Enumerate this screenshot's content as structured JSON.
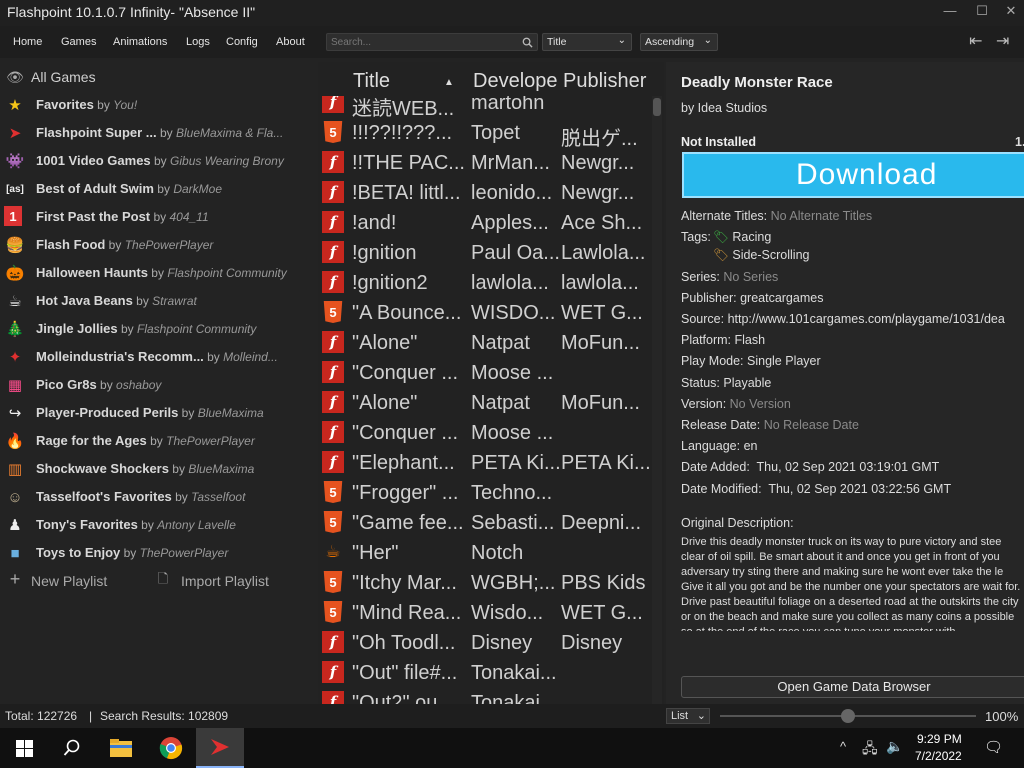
{
  "window": {
    "title": "Flashpoint 10.1.0.7 Infinity- \"Absence II\""
  },
  "menu": [
    "Home",
    "Games",
    "Animations",
    "Logs",
    "Config",
    "About"
  ],
  "search": {
    "placeholder": "Search..."
  },
  "sort": {
    "field": "Title",
    "order": "Ascending"
  },
  "sidebar": {
    "all_games": "All Games",
    "playlists": [
      {
        "name": "Favorites",
        "author": "You!",
        "icon": "star-icon"
      },
      {
        "name": "Flashpoint Super ...",
        "author": "BlueMaxima & Fla...",
        "icon": "flashpoint-icon"
      },
      {
        "name": "1001 Video Games",
        "author": "Gibus Wearing Brony",
        "icon": "space-invader-icon"
      },
      {
        "name": "Best of Adult Swim",
        "author": "DarkMoe",
        "icon": "adult-swim-icon"
      },
      {
        "name": "First Past the Post",
        "author": "404_11",
        "icon": "first-place-icon"
      },
      {
        "name": "Flash Food",
        "author": "ThePowerPlayer",
        "icon": "burger-icon"
      },
      {
        "name": "Halloween Haunts",
        "author": "Flashpoint Community",
        "icon": "pumpkin-icon"
      },
      {
        "name": "Hot Java Beans",
        "author": "Strawrat",
        "icon": "java-icon"
      },
      {
        "name": "Jingle Jollies",
        "author": "Flashpoint Community",
        "icon": "christmas-tree-icon"
      },
      {
        "name": "Molleindustria's Recomm...",
        "author": "Molleind...",
        "icon": "molleindustria-icon"
      },
      {
        "name": "Pico Gr8s",
        "author": "oshaboy",
        "icon": "pico-icon"
      },
      {
        "name": "Player-Produced Perils",
        "author": "BlueMaxima",
        "icon": "share-icon"
      },
      {
        "name": "Rage for the Ages",
        "author": "ThePowerPlayer",
        "icon": "fire-icon"
      },
      {
        "name": "Shockwave Shockers",
        "author": "BlueMaxima",
        "icon": "shockwave-icon"
      },
      {
        "name": "Tasselfoot's Favorites",
        "author": "Tasselfoot",
        "icon": "tasselfoot-icon"
      },
      {
        "name": "Tony's Favorites",
        "author": "Antony Lavelle",
        "icon": "tony-icon"
      },
      {
        "name": "Toys to Enjoy",
        "author": "ThePowerPlayer",
        "icon": "toys-icon"
      }
    ],
    "by_word": "by",
    "new_playlist": "New Playlist",
    "import_playlist": "Import Playlist"
  },
  "columns": {
    "title": "Title",
    "developer": "Develope",
    "publisher": "Publisher",
    "sort_arrow": "▲"
  },
  "games": [
    {
      "title": "迷読WEB...",
      "developer": "martohn",
      "publisher": "",
      "platform": "flash"
    },
    {
      "title": "!!!??!!???...",
      "developer": "Topet",
      "publisher": "脱出ゲ...",
      "platform": "html5"
    },
    {
      "title": "!!THE PAC...",
      "developer": "MrMan...",
      "publisher": "Newgr...",
      "platform": "flash"
    },
    {
      "title": "!BETA! littl...",
      "developer": "leonido...",
      "publisher": "Newgr...",
      "platform": "flash"
    },
    {
      "title": "!and!",
      "developer": "Apples...",
      "publisher": "Ace Sh...",
      "platform": "flash"
    },
    {
      "title": "!gnition",
      "developer": "Paul Oa...",
      "publisher": "Lawlola...",
      "platform": "flash"
    },
    {
      "title": "!gnition2",
      "developer": "lawlola...",
      "publisher": "lawlola...",
      "platform": "flash"
    },
    {
      "title": "\"A Bounce...",
      "developer": "WISDO...",
      "publisher": "WET G...",
      "platform": "html5"
    },
    {
      "title": "\"Alone\"",
      "developer": "Natpat",
      "publisher": "MoFun...",
      "platform": "flash"
    },
    {
      "title": "\"Conquer ...",
      "developer": "Moose ...",
      "publisher": "",
      "platform": "flash"
    },
    {
      "title": "\"Alone\"",
      "developer": "Natpat",
      "publisher": "MoFun...",
      "platform": "flash"
    },
    {
      "title": "\"Conquer ...",
      "developer": "Moose ...",
      "publisher": "",
      "platform": "flash"
    },
    {
      "title": "\"Elephant...",
      "developer": "PETA Ki...",
      "publisher": "PETA Ki...",
      "platform": "flash"
    },
    {
      "title": "\"Frogger\" ...",
      "developer": "Techno...",
      "publisher": "",
      "platform": "html5"
    },
    {
      "title": "\"Game fee...",
      "developer": "Sebasti...",
      "publisher": "Deepni...",
      "platform": "html5"
    },
    {
      "title": "\"Her\"",
      "developer": "Notch",
      "publisher": "",
      "platform": "java"
    },
    {
      "title": "\"Itchy Mar...",
      "developer": "WGBH;...",
      "publisher": "PBS Kids",
      "platform": "html5"
    },
    {
      "title": "\"Mind Rea...",
      "developer": "Wisdo...",
      "publisher": "WET G...",
      "platform": "html5"
    },
    {
      "title": "\"Oh Toodl...",
      "developer": "Disney",
      "publisher": "Disney",
      "platform": "flash"
    },
    {
      "title": "\"Out\" file#...",
      "developer": "Tonakai...",
      "publisher": "",
      "platform": "flash"
    },
    {
      "title": "\"Out2\" ou...",
      "developer": "Tonakai...",
      "publisher": "",
      "platform": "flash"
    }
  ],
  "details": {
    "title": "Deadly Monster Race",
    "by_line": "by Idea Studios",
    "install_status": "Not Installed",
    "size_fragment": "1.",
    "download_button": "Download",
    "alternate_titles_label": "Alternate Titles:",
    "alternate_titles_value": "No Alternate Titles",
    "tags_label": "Tags:",
    "tags": [
      "Racing",
      "Side-Scrolling"
    ],
    "series_label": "Series:",
    "series_value": "No Series",
    "publisher_label": "Publisher:",
    "publisher_value": "greatcargames",
    "source_label": "Source:",
    "source_value": "http://www.101cargames.com/playgame/1031/dea",
    "platform_label": "Platform:",
    "platform_value": "Flash",
    "play_mode_label": "Play Mode:",
    "play_mode_value": "Single Player",
    "status_label": "Status:",
    "status_value": "Playable",
    "version_label": "Version:",
    "version_value": "No Version",
    "release_date_label": "Release Date:",
    "release_date_value": "No Release Date",
    "language_label": "Language:",
    "language_value": "en",
    "date_added_label": "Date Added:",
    "date_added_value": "Thu, 02 Sep 2021 03:19:01 GMT",
    "date_modified_label": "Date Modified:",
    "date_modified_value": "Thu, 02 Sep 2021 03:22:56 GMT",
    "description_label": "Original Description:",
    "description": "Drive this deadly monster truck on its way to pure victory and stee clear of oil spill. Be smart about it and once you get in front of you adversary try sting there and making sure he wont ever take the le Give it all you got and be the number one your spectators are wait for. Drive past beautiful foliage on a deserted road at the outskirts the city or on the beach and make sure you collect as many coins a possible so at the end of the race you can tune your monster with",
    "open_game_data_browser": "Open Game Data Browser"
  },
  "status_bar": {
    "total": "Total: 122726",
    "separator": "|",
    "search_results": "Search Results: 102809",
    "view_mode": "List",
    "zoom": "100%",
    "zoom_level": 0.5
  },
  "taskbar": {
    "time": "9:29 PM",
    "date": "7/2/2022"
  },
  "colors": {
    "download": "#29b9ed",
    "flash": "#c8271e",
    "html5": "#e5531f"
  }
}
